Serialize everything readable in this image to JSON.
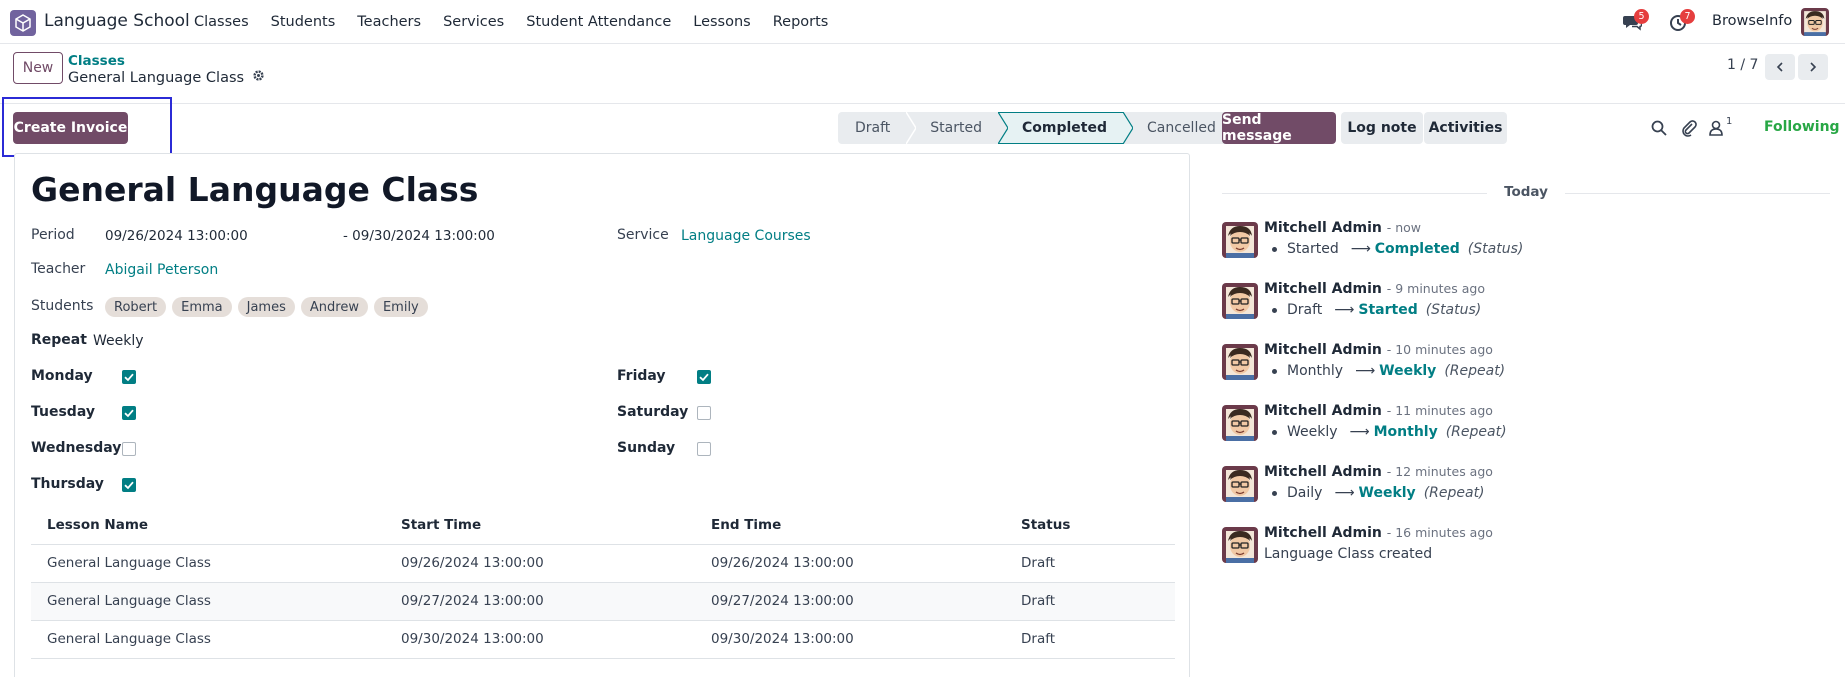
{
  "app": {
    "name": "Language School",
    "menu": [
      "Classes",
      "Students",
      "Teachers",
      "Services",
      "Student Attendance",
      "Lessons",
      "Reports"
    ],
    "messages_badge": "5",
    "activities_badge": "7",
    "company": "BrowseInfo"
  },
  "control": {
    "new_label": "New",
    "breadcrumb_parent": "Classes",
    "breadcrumb_current": "General Language Class",
    "pager": "1 / 7"
  },
  "statusbar": {
    "create_invoice": "Create Invoice",
    "stages": [
      "Draft",
      "Started",
      "Completed",
      "Cancelled"
    ],
    "active_stage": "Completed"
  },
  "form": {
    "title": "General Language Class",
    "period_label": "Period",
    "period_start": "09/26/2024 13:00:00",
    "period_end": "- 09/30/2024 13:00:00",
    "service_label": "Service",
    "service_value": "Language Courses",
    "teacher_label": "Teacher",
    "teacher_value": "Abigail Peterson",
    "students_label": "Students",
    "students": [
      "Robert",
      "Emma",
      "James",
      "Andrew",
      "Emily"
    ],
    "repeat_label": "Repeat",
    "repeat_value": "Weekly",
    "days": {
      "monday": {
        "label": "Monday",
        "checked": true
      },
      "tuesday": {
        "label": "Tuesday",
        "checked": true
      },
      "wednesday": {
        "label": "Wednesday",
        "checked": false
      },
      "thursday": {
        "label": "Thursday",
        "checked": true
      },
      "friday": {
        "label": "Friday",
        "checked": true
      },
      "saturday": {
        "label": "Saturday",
        "checked": false
      },
      "sunday": {
        "label": "Sunday",
        "checked": false
      }
    },
    "lessons": {
      "headers": [
        "Lesson Name",
        "Start Time",
        "End Time",
        "Status"
      ],
      "rows": [
        [
          "General Language Class",
          "09/26/2024 13:00:00",
          "09/26/2024 13:00:00",
          "Draft"
        ],
        [
          "General Language Class",
          "09/27/2024 13:00:00",
          "09/27/2024 13:00:00",
          "Draft"
        ],
        [
          "General Language Class",
          "09/30/2024 13:00:00",
          "09/30/2024 13:00:00",
          "Draft"
        ]
      ]
    }
  },
  "chatter": {
    "send_message": "Send message",
    "log_note": "Log note",
    "activities": "Activities",
    "followers_count": "1",
    "following": "Following",
    "today": "Today",
    "messages": [
      {
        "author": "Mitchell Admin",
        "time": "- now",
        "old": "Started",
        "new": "Completed",
        "field": "(Status)"
      },
      {
        "author": "Mitchell Admin",
        "time": "- 9 minutes ago",
        "old": "Draft",
        "new": "Started",
        "field": "(Status)"
      },
      {
        "author": "Mitchell Admin",
        "time": "- 10 minutes ago",
        "old": "Monthly",
        "new": "Weekly",
        "field": "(Repeat)"
      },
      {
        "author": "Mitchell Admin",
        "time": "- 11 minutes ago",
        "old": "Weekly",
        "new": "Monthly",
        "field": "(Repeat)"
      },
      {
        "author": "Mitchell Admin",
        "time": "- 12 minutes ago",
        "old": "Daily",
        "new": "Weekly",
        "field": "(Repeat)"
      },
      {
        "author": "Mitchell Admin",
        "time": "- 16 minutes ago",
        "text": "Language Class created"
      }
    ]
  },
  "colors": {
    "brand": "#714b67",
    "link": "#017e84",
    "following": "#28a745",
    "badge": "#e53e3e"
  }
}
